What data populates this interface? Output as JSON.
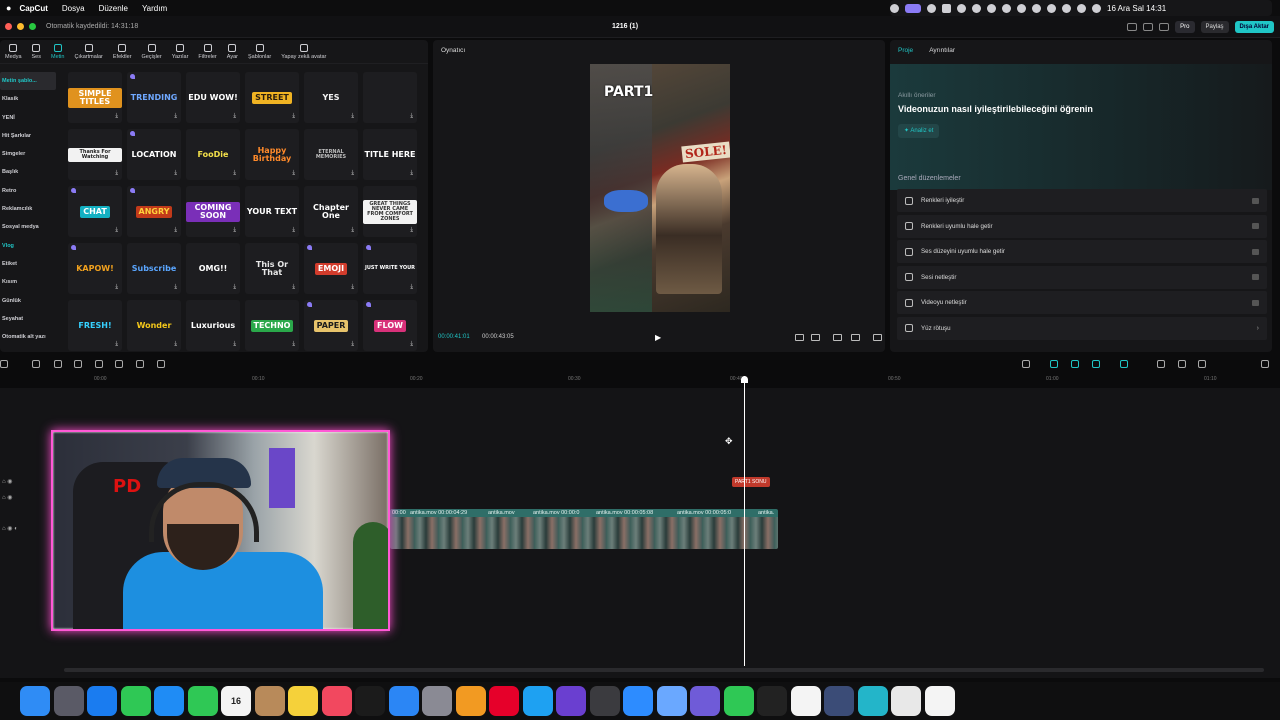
{
  "menubar": {
    "app": "CapCut",
    "menus": [
      "Dosya",
      "Düzenle",
      "Yardım"
    ],
    "clock": "16 Ara Sal  14:31"
  },
  "titlebar": {
    "saved": "Otomatik kaydedildi: 14:31:18",
    "project": "1216 (1)",
    "pro_label": "Pro",
    "share_label": "Paylaş",
    "export_label": "Dışa Aktar"
  },
  "toolbar": {
    "tools": [
      "Medya",
      "Ses",
      "Metin",
      "Çıkartmalar",
      "Efektler",
      "Geçişler",
      "Yazılar",
      "Filtreler",
      "Ayar",
      "Şablonlar",
      "Yapay zekâ avatar"
    ],
    "active": "Metin"
  },
  "categories": [
    "Metin şablo...",
    "Klasik",
    "YENİ",
    "Hit Şarkılar",
    "Simgeler",
    "Başlık",
    "Retro",
    "Reklamcılık",
    "Sosyal medya",
    "Vlog",
    "Etiket",
    "Kısım",
    "Günlük",
    "Seyahat",
    "Otomatik alt yazı"
  ],
  "filter_label": "Tr",
  "templates": [
    {
      "text": "SIMPLE TITLES",
      "color": "#ffffff",
      "bg": "#e0921e"
    },
    {
      "text": "TRENDING",
      "color": "#6fa8ff",
      "bg": ""
    },
    {
      "text": "EDU WOW!",
      "color": "#ffffff",
      "bg": ""
    },
    {
      "text": "STREET",
      "color": "#2b1d0d",
      "bg": "#f0b323"
    },
    {
      "text": "YES",
      "color": "#f2f2f2",
      "bg": ""
    },
    {
      "text": "",
      "color": "#ffffff",
      "bg": ""
    },
    {
      "text": "Thanks For Watching",
      "color": "#222222",
      "bg": "#f2f2f2"
    },
    {
      "text": "LOCATION",
      "color": "#ffffff",
      "bg": ""
    },
    {
      "text": "FooDie",
      "color": "#f3e04a",
      "bg": ""
    },
    {
      "text": "Happy Birthday",
      "color": "#ff8a2a",
      "bg": ""
    },
    {
      "text": "ETERNAL MEMORIES",
      "color": "#bdbdbd",
      "bg": ""
    },
    {
      "text": "TITLE HERE",
      "color": "#ffffff",
      "bg": ""
    },
    {
      "text": "CHAT",
      "color": "#ffffff",
      "bg": "#13b0c2"
    },
    {
      "text": "ANGRY",
      "color": "#ffd23c",
      "bg": "#c23a1a"
    },
    {
      "text": "COMING SOON",
      "color": "#ffffff",
      "bg": "#7a2fb8"
    },
    {
      "text": "YOUR TEXT",
      "color": "#ffffff",
      "bg": ""
    },
    {
      "text": "Chapter One",
      "color": "#ffffff",
      "bg": ""
    },
    {
      "text": "GREAT THINGS NEVER CAME FROM COMFORT ZONES",
      "color": "#333333",
      "bg": "#f2f2f2"
    },
    {
      "text": "KAPOW!",
      "color": "#f1a11e",
      "bg": ""
    },
    {
      "text": "Subscribe",
      "color": "#5aa6ff",
      "bg": ""
    },
    {
      "text": "OMG!!",
      "color": "#ffffff",
      "bg": ""
    },
    {
      "text": "This Or That",
      "color": "#e8e8e8",
      "bg": ""
    },
    {
      "text": "EMOJI",
      "color": "#ffffff",
      "bg": "#d23c2c"
    },
    {
      "text": "JUST WRITE YOUR",
      "color": "#ffffff",
      "bg": ""
    },
    {
      "text": "FRESH!",
      "color": "#36d1ff",
      "bg": ""
    },
    {
      "text": "Wonder",
      "color": "#f3c71a",
      "bg": ""
    },
    {
      "text": "Luxurious",
      "color": "#ffffff",
      "bg": ""
    },
    {
      "text": "TECHNO",
      "color": "#ffffff",
      "bg": "#2aa84a"
    },
    {
      "text": "PAPER",
      "color": "#1b1b1b",
      "bg": "#e7c36b"
    },
    {
      "text": "FLOW",
      "color": "#ffffff",
      "bg": "#d8317a"
    }
  ],
  "player": {
    "title": "Oynatıcı",
    "current_time": "00:00:41:01",
    "total_time": "00:00:43:05",
    "overlay_part": "PART1",
    "overlay_sign": "SOLE!"
  },
  "rightpanel": {
    "tabs": [
      "Proje",
      "Ayrıntılar"
    ],
    "ai_label": "Akıllı öneriler",
    "ai_title": "Videonuzun nasıl iyileştirilebileceğini öğrenin",
    "analyze": "Analiz et",
    "general": "Genel düzenlemeler",
    "items": [
      "Renkleri iyileştir",
      "Renkleri uyumlu hale getir",
      "Ses düzeyini uyumlu hale getir",
      "Sesi netleştir",
      "Videoyu netleştir",
      "Yüz rötuşu"
    ]
  },
  "ruler": [
    "00:00",
    "00:10",
    "00:20",
    "00:30",
    "00:40",
    "00:50",
    "01:00",
    "01:10"
  ],
  "timeline": {
    "marker": "PART1 SONU",
    "clips": [
      {
        "label": "00:00"
      },
      {
        "label": "antika.mov  00:00:04:29"
      },
      {
        "label": "antika.mov"
      },
      {
        "label": "antika.mov  00:00:0"
      },
      {
        "label": "antika.mov  00:00:05:08"
      },
      {
        "label": "antika.mov  00:00:05:0"
      },
      {
        "label": "antika."
      }
    ]
  },
  "dock": {
    "apps": [
      "Finder",
      "Launchpad",
      "Safari",
      "Messages",
      "Mail",
      "FaceTime",
      "Calendar",
      "Contacts",
      "Notes",
      "Music",
      "TV",
      "App Store",
      "System Settings",
      "Pages",
      "Pinterest",
      "Edge",
      "Masters Player",
      "Activity",
      "Zoom",
      "Preview",
      "Keka",
      "WhatsApp",
      "Final Cut",
      "ChatGPT",
      "Disk Util",
      "Canva",
      "Chrome",
      "CapCut"
    ],
    "calendar_day": "16"
  },
  "colors": {
    "accent": "#20c6c6",
    "webcam_border": "#ff59d6",
    "marker": "#c0392b"
  }
}
